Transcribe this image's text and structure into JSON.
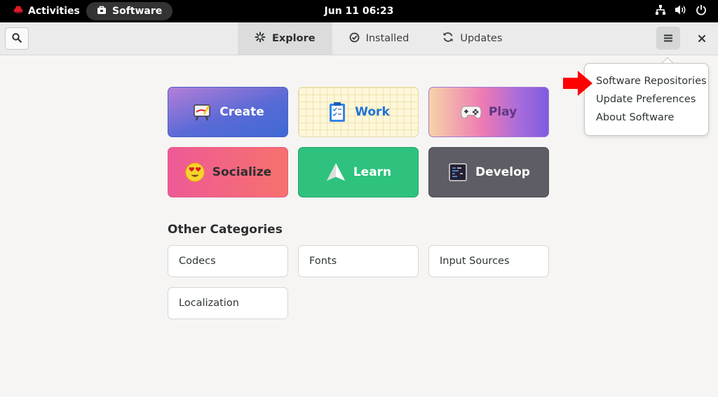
{
  "topbar": {
    "activities_label": "Activities",
    "app_name": "Software",
    "clock": "Jun 11  06:23",
    "tray_icons": [
      "network-icon",
      "volume-icon",
      "power-icon"
    ]
  },
  "header": {
    "search_icon": "search-icon",
    "tabs": [
      {
        "label": "Explore",
        "icon": "explore-icon",
        "active": true
      },
      {
        "label": "Installed",
        "icon": "check-circle-icon",
        "active": false
      },
      {
        "label": "Updates",
        "icon": "refresh-icon",
        "active": false
      }
    ],
    "menu_icon": "hamburger-icon",
    "close_icon": "close-icon"
  },
  "categories": [
    {
      "label": "Create",
      "icon": "easel-icon"
    },
    {
      "label": "Work",
      "icon": "clipboard-icon"
    },
    {
      "label": "Play",
      "icon": "gamepad-icon"
    },
    {
      "label": "Socialize",
      "icon": "heart-eyes-emoji-icon"
    },
    {
      "label": "Learn",
      "icon": "paper-plane-icon"
    },
    {
      "label": "Develop",
      "icon": "terminal-icon"
    }
  ],
  "other": {
    "title": "Other Categories",
    "items": [
      "Codecs",
      "Fonts",
      "Input Sources",
      "Localization"
    ]
  },
  "menu": {
    "items": [
      "Software Repositories",
      "Update Preferences",
      "About Software"
    ]
  },
  "colors": {
    "annotation_arrow": "#ff0000",
    "work_text": "#1c71d8",
    "learn_bg": "#2ec27e",
    "develop_bg": "#5e5c64"
  }
}
